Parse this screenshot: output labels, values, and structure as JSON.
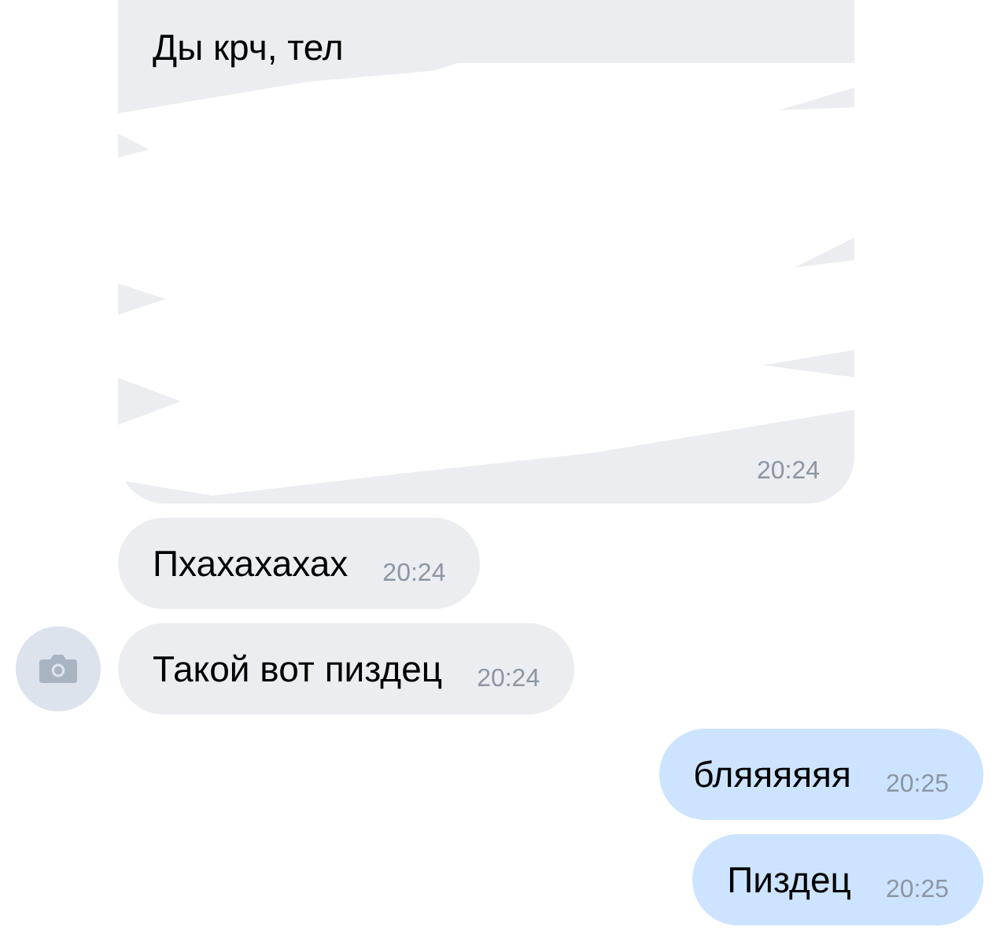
{
  "messages": [
    {
      "kind": "incoming",
      "text": "Ды крч, тел",
      "time": "20:24",
      "redacted": true,
      "avatar": false
    },
    {
      "kind": "incoming",
      "text": "Пхахахахах",
      "time": "20:24",
      "redacted": false,
      "avatar": false
    },
    {
      "kind": "incoming",
      "text": "Такой вот пиздец",
      "time": "20:24",
      "redacted": false,
      "avatar": true
    },
    {
      "kind": "outgoing",
      "text": "бляяяяяя",
      "time": "20:25",
      "redacted": false,
      "avatar": false
    },
    {
      "kind": "outgoing",
      "text": "Пиздец",
      "time": "20:25",
      "redacted": false,
      "avatar": false
    }
  ]
}
